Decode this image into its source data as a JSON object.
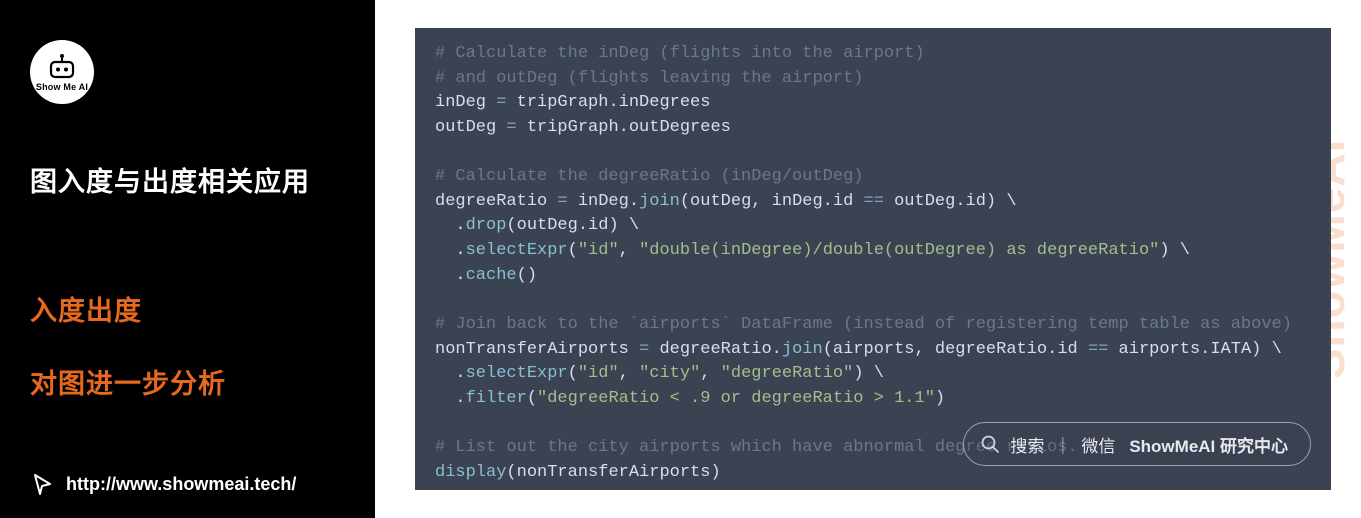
{
  "sidebar": {
    "logo_text": "Show Me AI",
    "heading": "图入度与出度相关应用",
    "subitems": [
      "入度出度",
      "对图进一步分析"
    ],
    "footer_url": "http://www.showmeai.tech/"
  },
  "watermark": "ShowMeAI",
  "search": {
    "prefix": "搜索",
    "mid": "微信",
    "bold": "ShowMeAI 研究中心"
  },
  "code": {
    "l1": "# Calculate the inDeg (flights into the airport)",
    "l2": "# and outDeg (flights leaving the airport)",
    "l3a": "inDeg ",
    "l3b": "=",
    "l3c": " tripGraph.inDegrees",
    "l4a": "outDeg ",
    "l4b": "=",
    "l4c": " tripGraph.outDegrees",
    "l5": "# Calculate the degreeRatio (inDeg/outDeg)",
    "l6a": "degreeRatio ",
    "l6b": "=",
    "l6c": " inDeg.",
    "l6d": "join",
    "l6e": "(outDeg, inDeg.id ",
    "l6f": "==",
    "l6g": " outDeg.id) \\",
    "l7a": "  .",
    "l7b": "drop",
    "l7c": "(outDeg.id) \\",
    "l8a": "  .",
    "l8b": "selectExpr",
    "l8c": "(",
    "l8d": "\"id\"",
    "l8e": ", ",
    "l8f": "\"double(inDegree)/double(outDegree) as degreeRatio\"",
    "l8g": ") \\",
    "l9a": "  .",
    "l9b": "cache",
    "l9c": "()",
    "l10": "# Join back to the `airports` DataFrame (instead of registering temp table as above)",
    "l11a": "nonTransferAirports ",
    "l11b": "=",
    "l11c": " degreeRatio.",
    "l11d": "join",
    "l11e": "(airports, degreeRatio.id ",
    "l11f": "==",
    "l11g": " airports.IATA) \\",
    "l12a": "  .",
    "l12b": "selectExpr",
    "l12c": "(",
    "l12d": "\"id\"",
    "l12e": ", ",
    "l12f": "\"city\"",
    "l12g": ", ",
    "l12h": "\"degreeRatio\"",
    "l12i": ") \\",
    "l13a": "  .",
    "l13b": "filter",
    "l13c": "(",
    "l13d": "\"degreeRatio < .9 or degreeRatio > 1.1\"",
    "l13e": ")",
    "l14": "# List out the city airports which have abnormal degree ratios.",
    "l15a": "display",
    "l15b": "(nonTransferAirports)"
  }
}
